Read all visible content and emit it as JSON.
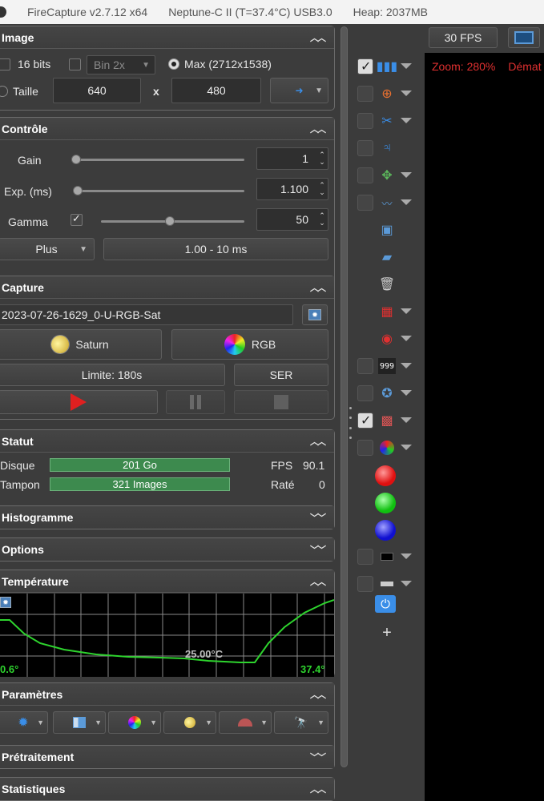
{
  "titlebar": {
    "app": "FireCapture v2.7.12 x64",
    "camera": "Neptune-C II (T=37.4°C) USB3.0",
    "heap": "Heap: 2037MB"
  },
  "image": {
    "title": "Image",
    "bits_label": "16 bits",
    "bin_value": "Bin 2x",
    "max_label": "Max (2712x1538)",
    "size_label": "Taille",
    "width": "640",
    "x_label": "x",
    "height": "480"
  },
  "control": {
    "title": "Contrôle",
    "gain_label": "Gain",
    "gain_value": "1",
    "gain_level": 0.0,
    "exp_label": "Exp. (ms)",
    "exp_value": "1.100",
    "exp_level": 0.0,
    "gamma_label": "Gamma",
    "gamma_value": "50",
    "gamma_level": 0.5,
    "more_label": "Plus",
    "range_label": "1.00 - 10 ms"
  },
  "capture": {
    "title": "Capture",
    "filename": "2023-07-26-1629_0-U-RGB-Sat",
    "object_label": "Saturn",
    "filter_label": "RGB",
    "limit_label": "Limite: 180s",
    "format_label": "SER"
  },
  "status": {
    "title": "Statut",
    "disk_label": "Disque",
    "disk_value": "201 Go",
    "fps_label": "FPS",
    "fps_value": "90.1",
    "buffer_label": "Tampon",
    "buffer_value": "321 Images",
    "missed_label": "Raté",
    "missed_value": "0"
  },
  "histogram": {
    "title": "Histogramme"
  },
  "options": {
    "title": "Options"
  },
  "temperature": {
    "title": "Température",
    "center": "25.00°C",
    "min": "0.6°",
    "max": "37.4°"
  },
  "params": {
    "title": "Paramètres"
  },
  "preprocessing": {
    "title": "Prétraitement"
  },
  "stats": {
    "title": "Statistiques"
  },
  "viewer": {
    "fps_button": "30 FPS",
    "zoom": "Zoom: 280%",
    "demat": "Démat"
  },
  "colors": {
    "accent": "#2f86d6",
    "status_bar": "#3d8a4e",
    "record": "#e02020",
    "temp_curve": "#2ed42e",
    "overlay_text": "#e03030"
  }
}
